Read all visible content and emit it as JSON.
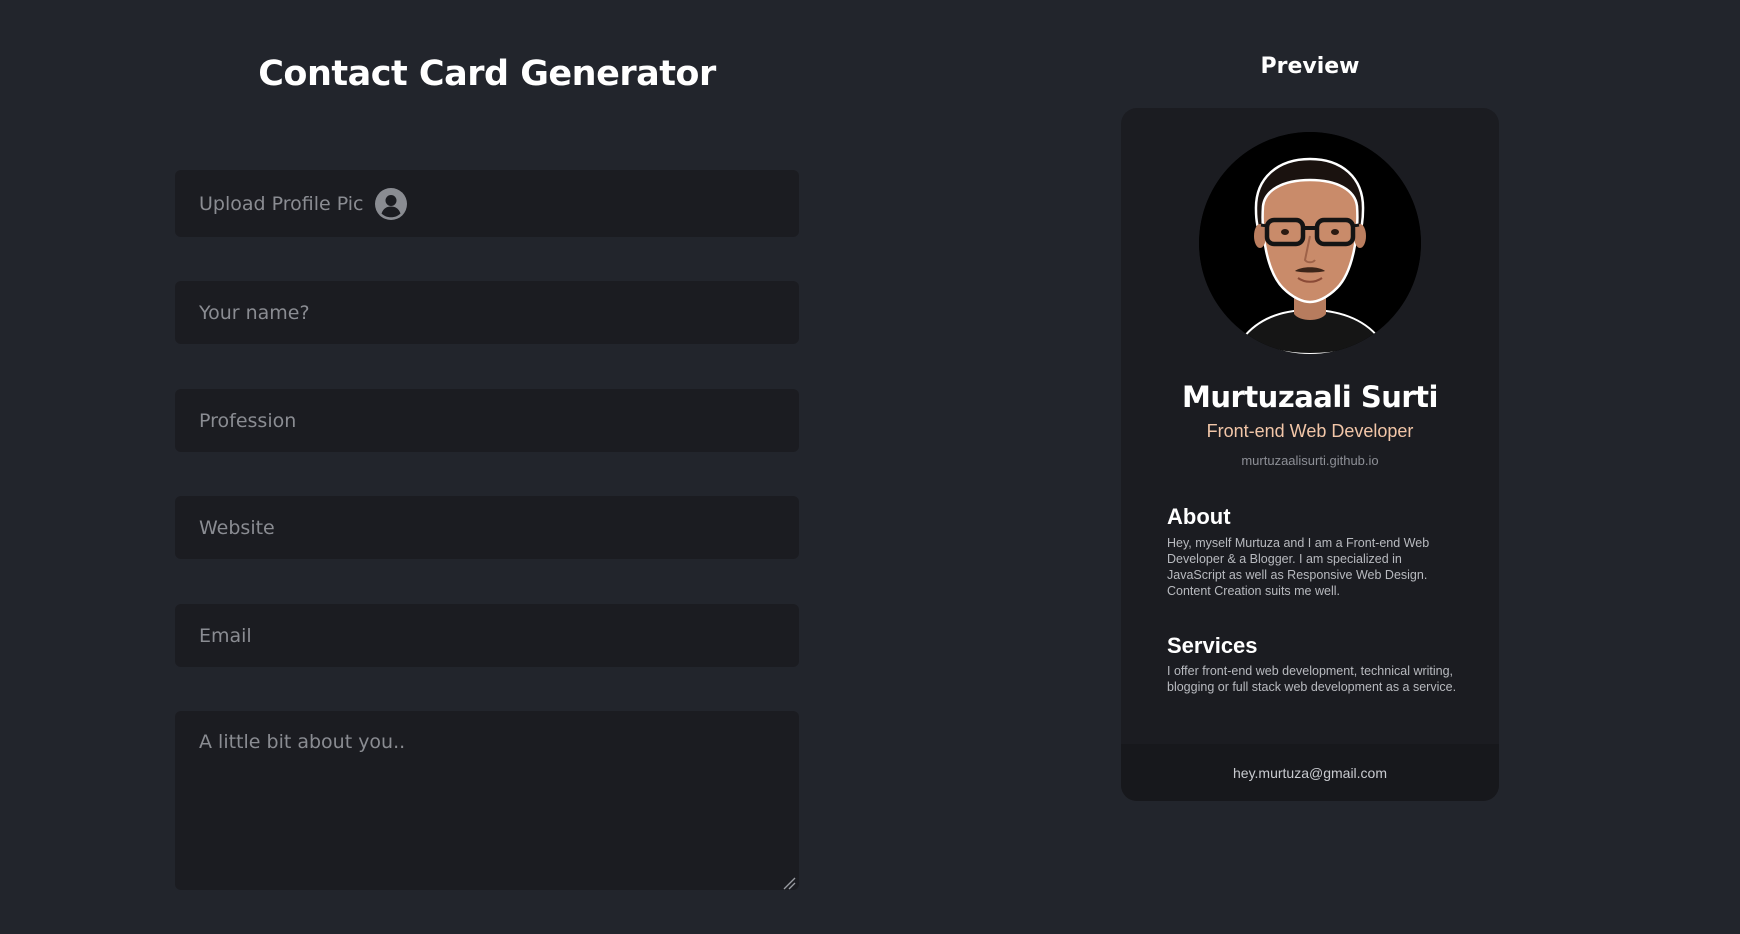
{
  "form": {
    "title": "Contact Card Generator",
    "upload_label": "Upload Profile Pic",
    "upload_icon": "user-circle-icon",
    "name_placeholder": "Your name?",
    "profession_placeholder": "Profession",
    "website_placeholder": "Website",
    "email_placeholder": "Email",
    "about_placeholder": "A little bit about you.."
  },
  "preview": {
    "title": "Preview",
    "card": {
      "name": "Murtuzaali Surti",
      "profession": "Front-end Web Developer",
      "website": "murtuzaalisurti.github.io",
      "about_heading": "About",
      "about_text": "Hey, myself Murtuza and I am a Front-end Web Developer & a Blogger. I am specialized in JavaScript as well as Responsive Web Design. Content Creation suits me well.",
      "services_heading": "Services",
      "services_text": "I offer front-end web development, technical writing, blogging or full stack web development as a service.",
      "email": "hey.murtuza@gmail.com"
    }
  },
  "colors": {
    "background": "#22252c",
    "field": "#1b1c21",
    "card": "#1b1c21",
    "card_footer": "#17181c",
    "profession_accent": "#f2c6a8"
  }
}
